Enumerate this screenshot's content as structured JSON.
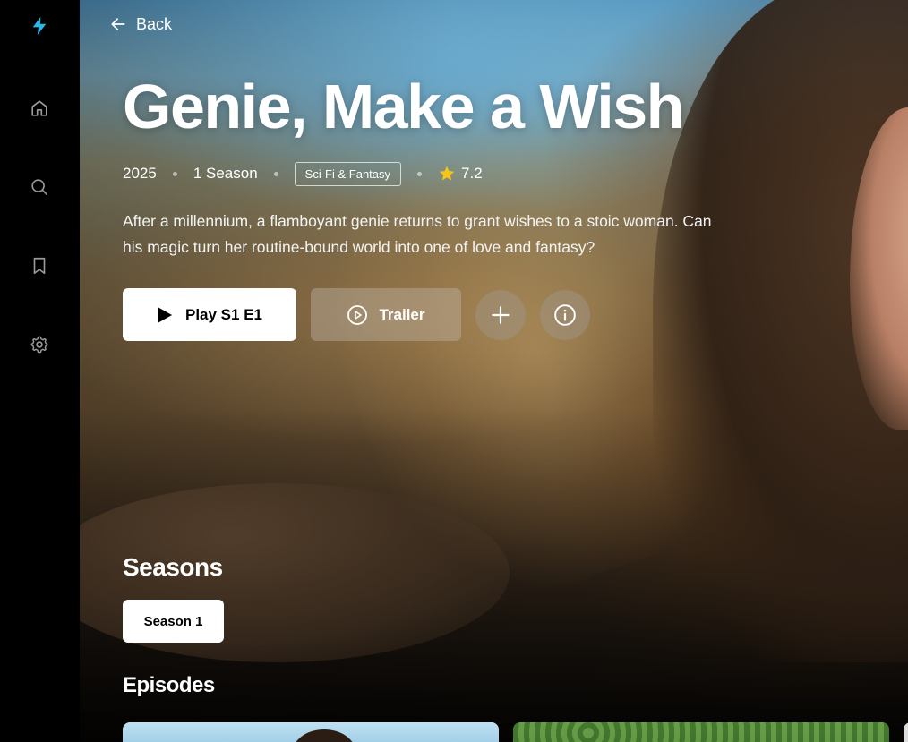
{
  "sidebar": {
    "items": [
      {
        "name": "home",
        "icon": "home-icon"
      },
      {
        "name": "search",
        "icon": "search-icon"
      },
      {
        "name": "watchlist",
        "icon": "bookmark-icon"
      },
      {
        "name": "settings",
        "icon": "gear-icon"
      }
    ],
    "logo_icon": "lightning-bolt-icon",
    "accent_color": "#2bb8e8"
  },
  "header": {
    "back_label": "Back"
  },
  "show": {
    "title": "Genie, Make a Wish",
    "year": "2025",
    "seasons_count": "1 Season",
    "genre": "Sci-Fi & Fantasy",
    "rating": "7.2",
    "description": "After a millennium, a flamboyant genie returns to grant wishes to a stoic woman. Can his magic turn her routine-bound world into one of love and fantasy?"
  },
  "actions": {
    "play_label": "Play S1 E1",
    "trailer_label": "Trailer",
    "add_icon": "plus-icon",
    "info_icon": "info-icon"
  },
  "seasons": {
    "heading": "Seasons",
    "items": [
      {
        "label": "Season 1",
        "selected": true
      }
    ]
  },
  "episodes": {
    "heading": "Episodes"
  },
  "colors": {
    "star": "#f5c518",
    "play_button_bg": "#ffffff"
  }
}
